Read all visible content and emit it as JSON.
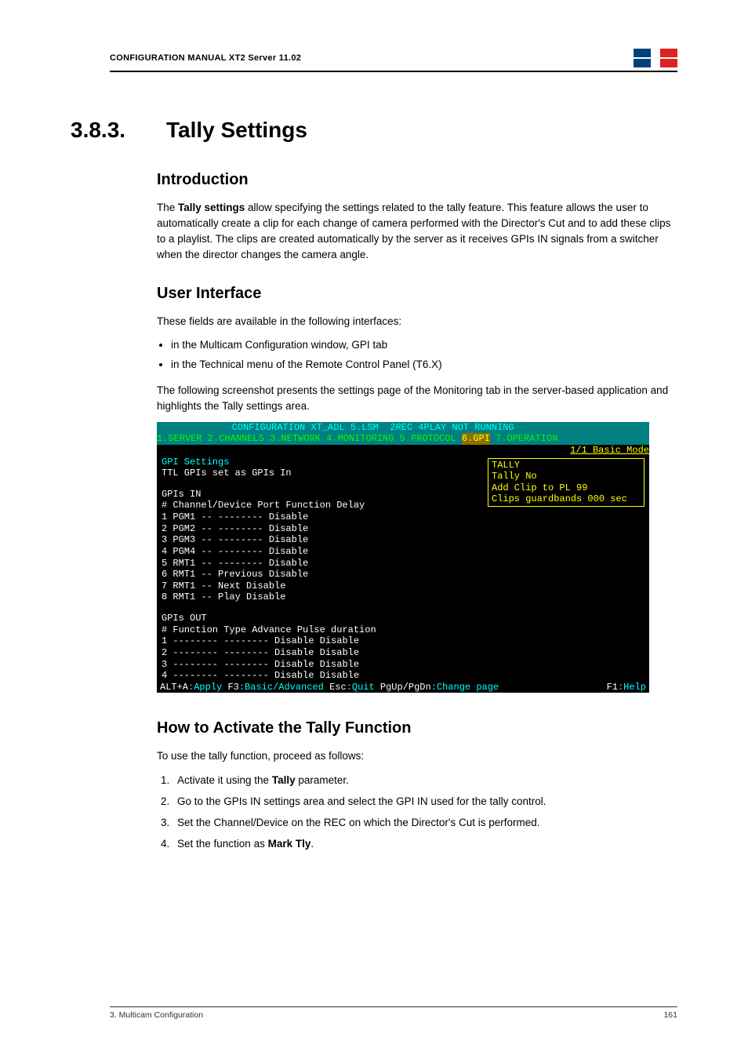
{
  "header": {
    "title": "CONFIGURATION MANUAL XT2 Server 11.02"
  },
  "section": {
    "number": "3.8.3.",
    "title": "Tally Settings"
  },
  "intro": {
    "heading": "Introduction",
    "p1a": "The ",
    "p1b": "Tally settings",
    "p1c": " allow specifying the settings related to the tally feature. This feature allows the user to automatically create a clip for each change of camera performed with the Director's Cut and to add these clips to a playlist. The clips are created automatically by the server as it receives GPIs IN signals from a switcher when the director changes the camera angle."
  },
  "ui": {
    "heading": "User Interface",
    "p1": "These fields are available in the following interfaces:",
    "li1": "in the Multicam Configuration window, GPI tab",
    "li2": "in the Technical menu of the Remote Control Panel (T6.X)",
    "p2": "The following screenshot presents the settings page of the Monitoring tab in the server-based application and highlights the Tally settings area."
  },
  "terminal": {
    "title_line": "             CONFIGURATION XT_ADL 5.LSM  2REC 4PLAY NOT RUNNING",
    "tabs": "1.SERVER 2.CHANNELS 3.NETWORK 4.MONITORING 5.PROTOCOL ",
    "tab_active": "6.GPI",
    "tabs_end": " 7.OPERATION",
    "mode": "1/1 Basic Mode",
    "gpi_settings": "GPI Settings",
    "ttl": "TTL GPIs set as GPIs In",
    "tally_h": "TALLY",
    "tally_no": "Tally No",
    "add_clip": "Add Clip to PL 99",
    "clips_gb": "Clips guardbands 000 sec",
    "gpis_in": "GPIs IN",
    "in_hdr": "#   Channel/Device Port   Function Delay",
    "in1": "1   PGM1           --     -------- Disable",
    "in2": "2   PGM2           --     -------- Disable",
    "in3": "3   PGM3           --     -------- Disable",
    "in4": "4   PGM4           --     -------- Disable",
    "in5": "5   RMT1           --     -------- Disable",
    "in6": "6   RMT1           --     Previous Disable",
    "in7": "7   RMT1           --     Next     Disable",
    "in8": "8   RMT1           --     Play     Disable",
    "gpis_out": "GPIs OUT",
    "out_hdr": "#   Function       Type        Advance Pulse duration",
    "out1": "1   --------       --------    Disable Disable",
    "out2": "2   --------       --------    Disable Disable",
    "out3": "3   --------       --------    Disable Disable",
    "out4": "4   --------       --------    Disable Disable",
    "footer_a": "ALT+A",
    "footer_a2": ":Apply ",
    "footer_b": "F3",
    "footer_b2": ":Basic/Advanced ",
    "footer_c": "Esc",
    "footer_c2": ":Quit ",
    "footer_d": "PgUp/PgDn",
    "footer_d2": ":Change page",
    "footer_e": "F1",
    "footer_e2": ":Help"
  },
  "howto": {
    "heading": "How to Activate the Tally Function",
    "p1": "To use the tally function, proceed as follows:",
    "li1a": "Activate it using the ",
    "li1b": "Tally",
    "li1c": " parameter.",
    "li2": "Go to the GPIs IN settings area and select the GPI IN used for the tally control.",
    "li3": "Set the Channel/Device on the REC on which the Director's Cut is performed.",
    "li4a": "Set the function as ",
    "li4b": "Mark Tly",
    "li4c": "."
  },
  "footer": {
    "left": "3. Multicam Configuration",
    "right": "161"
  }
}
